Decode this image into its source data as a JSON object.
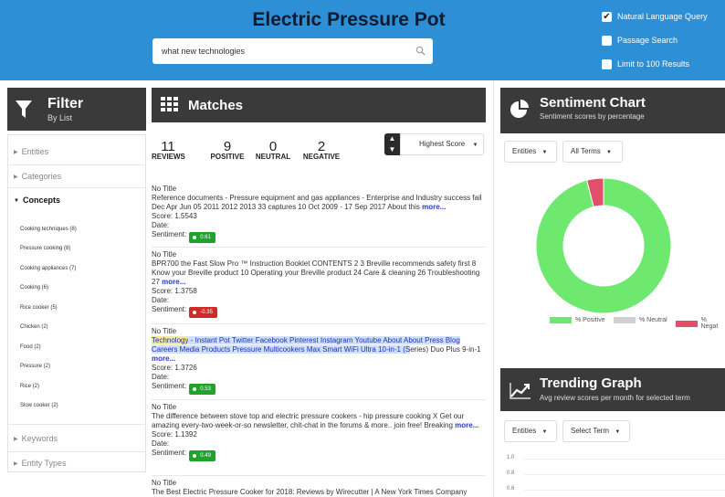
{
  "header": {
    "title": "Electric Pressure Pot",
    "search_value": "what new technologies",
    "options": [
      {
        "label": "Natural Language Query",
        "checked": true
      },
      {
        "label": "Passage Search",
        "checked": false
      },
      {
        "label": "Limit to 100 Results",
        "checked": false
      }
    ]
  },
  "filter": {
    "title": "Filter",
    "subtitle": "By List",
    "sections": [
      "Entities",
      "Categories",
      "Concepts",
      "Keywords",
      "Entity Types"
    ],
    "concepts": [
      "Cooking techniques (8)",
      "Pressure cooking (8)",
      "Cooking appliances (7)",
      "Cooking (6)",
      "Rice cooker (5)",
      "Chicken (2)",
      "Food (2)",
      "Pressure (2)",
      "Rice (2)",
      "Slow cooker (2)"
    ]
  },
  "matches": {
    "title": "Matches",
    "stats": [
      {
        "num": "11",
        "label": "REVIEWS"
      },
      {
        "num": "9",
        "label": "POSITIVE"
      },
      {
        "num": "0",
        "label": "NEUTRAL"
      },
      {
        "num": "2",
        "label": "NEGATIVE"
      }
    ],
    "sort_label": "Highest Score",
    "more_label": "more...",
    "date_label": "Date:",
    "sentiment_label": "Sentiment:",
    "results": [
      {
        "title": "No Title",
        "text": "Reference documents - Pressure equipment and gas appliances - Enterprise and Industry success fail Dec Apr Jun 05 2011 2012 2013 33 captures 10 Oct 2009 - 17 Sep 2017 About this",
        "score": "Score: 1.5543",
        "sentiment": "0.61"
      },
      {
        "title": "No Title",
        "text": "BPR700 the Fast Slow Pro ™ Instruction Booklet CONTENTS 2 3 Breville recommends safety first 8 Know your Breville product 10 Operating your Breville product 24 Care & cleaning 26 Troubleshooting 27",
        "score": "Score: 1.3758",
        "sentiment": "-0.35"
      },
      {
        "title": "No Title",
        "text_hl1": "Technology",
        "text_hl2": " - Instant Pot Twitter Facebook Pinterest Instagram Youtube About About Press Blog Careers Media Products Pressure Multicookers Max Smart WiFi Ultra 10-in-1 (S",
        "text_rest": "eries) Duo Plus 9-in-1",
        "score": "Score: 1.3726",
        "sentiment": "0.53"
      },
      {
        "title": "No Title",
        "text": "The difference between stove top and electric pressure cookers - hip pressure cooking X Get our amazing every-two-week-or-so newsletter, chit-chat in the forums & more.. join free! Breaking",
        "score": "Score: 1.1392",
        "sentiment": "0.49"
      },
      {
        "title": "No Title",
        "text": "The Best Electric Pressure Cooker for 2018: Reviews by Wirecutter | A New York Times Company"
      }
    ]
  },
  "sentiment_chart": {
    "title": "Sentiment Chart",
    "subtitle": "Sentiment scores by percentage",
    "dropdown1": "Entities",
    "dropdown2": "All Terms",
    "legend": [
      "% Positive",
      "% Neutral",
      "% Negat"
    ],
    "colors": {
      "positive": "#6ee86e",
      "neutral": "#d0d0d0",
      "negative": "#e0506a"
    }
  },
  "chart_data": {
    "type": "pie",
    "categories": [
      "% Positive",
      "% Neutral",
      "% Negative"
    ],
    "values": [
      96,
      0,
      4
    ]
  },
  "trending": {
    "title": "Trending Graph",
    "subtitle": "Avg review scores per month for selected term",
    "dropdown1": "Entities",
    "dropdown2": "Select Term",
    "yticks": [
      "1.0",
      "0.8",
      "0.6"
    ]
  }
}
